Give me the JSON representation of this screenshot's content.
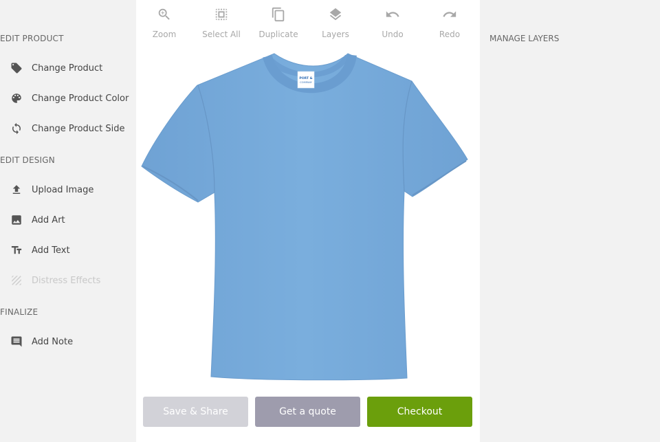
{
  "sidebar": {
    "sections": [
      {
        "title": "EDIT PRODUCT",
        "items": [
          {
            "label": "Change Product",
            "icon": "tag-icon",
            "enabled": true
          },
          {
            "label": "Change Product Color",
            "icon": "palette-icon",
            "enabled": true
          },
          {
            "label": "Change Product Side",
            "icon": "rotate-icon",
            "enabled": true
          }
        ]
      },
      {
        "title": "EDIT DESIGN",
        "items": [
          {
            "label": "Upload Image",
            "icon": "upload-icon",
            "enabled": true
          },
          {
            "label": "Add Art",
            "icon": "image-icon",
            "enabled": true
          },
          {
            "label": "Add Text",
            "icon": "text-icon",
            "enabled": true
          },
          {
            "label": "Distress Effects",
            "icon": "texture-icon",
            "enabled": false
          }
        ]
      },
      {
        "title": "FINALIZE",
        "items": [
          {
            "label": "Add Note",
            "icon": "comment-icon",
            "enabled": true
          }
        ]
      }
    ]
  },
  "toolbar": {
    "tools": [
      {
        "label": "Zoom",
        "icon": "zoom-in-icon"
      },
      {
        "label": "Select All",
        "icon": "select-all-icon"
      },
      {
        "label": "Duplicate",
        "icon": "duplicate-icon"
      },
      {
        "label": "Layers",
        "icon": "layers-icon"
      },
      {
        "label": "Undo",
        "icon": "undo-icon"
      },
      {
        "label": "Redo",
        "icon": "redo-icon"
      }
    ]
  },
  "product": {
    "type": "t-shirt",
    "color": "#78aad9",
    "tag_text": [
      "PORT &",
      "COMPANY"
    ]
  },
  "actions": {
    "save_share": "Save & Share",
    "get_quote": "Get a quote",
    "checkout": "Checkout"
  },
  "right_panel": {
    "title": "MANAGE LAYERS"
  },
  "colors": {
    "checkout": "#6b9f0c",
    "quote": "#9e9cad",
    "share": "#d2d2d8",
    "icon": "#555555",
    "toolbar_icon": "#a8a8a8"
  }
}
